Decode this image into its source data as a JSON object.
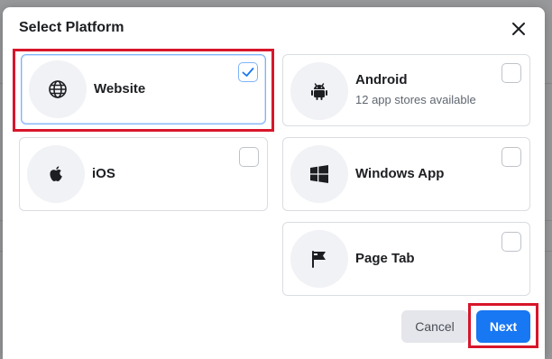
{
  "dialog": {
    "title": "Select Platform",
    "close_icon": "close-icon"
  },
  "platforms": [
    {
      "name": "Website",
      "subtitle": "",
      "icon": "globe-icon",
      "selected": true
    },
    {
      "name": "Android",
      "subtitle": "12 app stores available",
      "icon": "android-icon",
      "selected": false
    },
    {
      "name": "iOS",
      "subtitle": "",
      "icon": "apple-icon",
      "selected": false
    },
    {
      "name": "Windows App",
      "subtitle": "",
      "icon": "windows-icon",
      "selected": false
    },
    {
      "name": "Page Tab",
      "subtitle": "",
      "icon": "flag-icon",
      "selected": false
    }
  ],
  "footer": {
    "cancel_label": "Cancel",
    "next_label": "Next"
  },
  "colors": {
    "accent": "#1877f2",
    "highlight": "#d7162b"
  }
}
